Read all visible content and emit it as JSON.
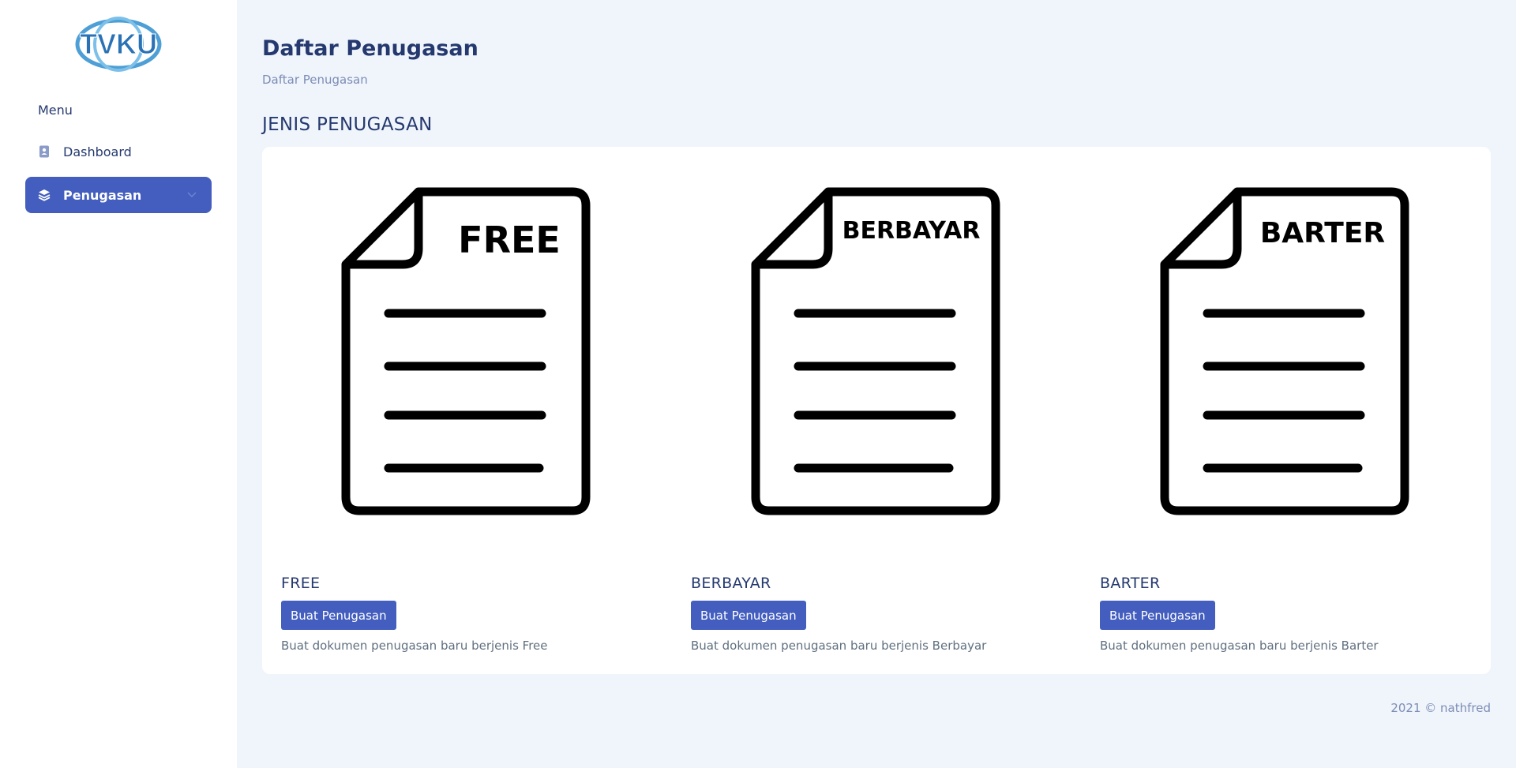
{
  "brand": {
    "logo_text": "TVKU"
  },
  "sidebar": {
    "menu_title": "Menu",
    "items": [
      {
        "label": "Dashboard",
        "icon": "contact-book-icon",
        "active": false
      },
      {
        "label": "Penugasan",
        "icon": "layers-icon",
        "active": true
      }
    ]
  },
  "header": {
    "title": "Daftar Penugasan",
    "breadcrumb": "Daftar Penugasan"
  },
  "section": {
    "title": "JENIS PENUGASAN",
    "types": [
      {
        "image_label": "FREE",
        "title": "FREE",
        "button_label": "Buat Penugasan",
        "description": "Buat dokumen penugasan baru berjenis Free"
      },
      {
        "image_label": "BERBAYAR",
        "title": "BERBAYAR",
        "button_label": "Buat Penugasan",
        "description": "Buat dokumen penugasan baru berjenis Berbayar"
      },
      {
        "image_label": "BARTER",
        "title": "BARTER",
        "button_label": "Buat Penugasan",
        "description": "Buat dokumen penugasan baru berjenis Barter"
      }
    ]
  },
  "footer": {
    "text": "2021 © nathfred"
  },
  "colors": {
    "primary": "#435ebe",
    "heading": "#25396f",
    "background": "#f0f5fc",
    "muted": "#7c8db5"
  }
}
